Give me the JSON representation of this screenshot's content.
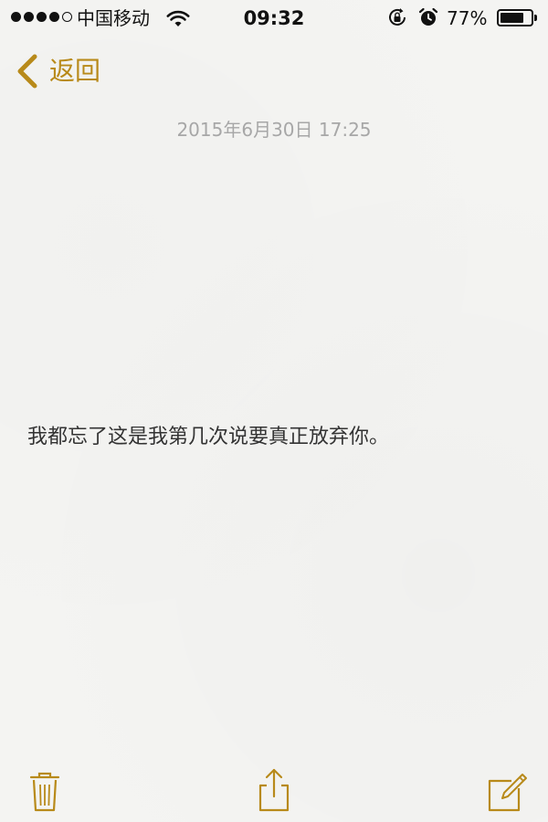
{
  "status_bar": {
    "signal_bars_filled": 4,
    "signal_bars_total": 5,
    "carrier": "中国移动",
    "time": "09:32",
    "battery_percent_text": "77%",
    "battery_level": 0.77
  },
  "nav": {
    "back_label": "返回"
  },
  "note": {
    "timestamp": "2015年6月30日 17:25",
    "body": "我都忘了这是我第几次说要真正放弃你。"
  },
  "toolbar": {
    "icons": [
      "trash-icon",
      "share-icon",
      "compose-icon"
    ]
  },
  "colors": {
    "accent": "#b88a1a",
    "timestamp": "#a7a7a7",
    "text": "#333333",
    "background": "#f4f4f2"
  }
}
